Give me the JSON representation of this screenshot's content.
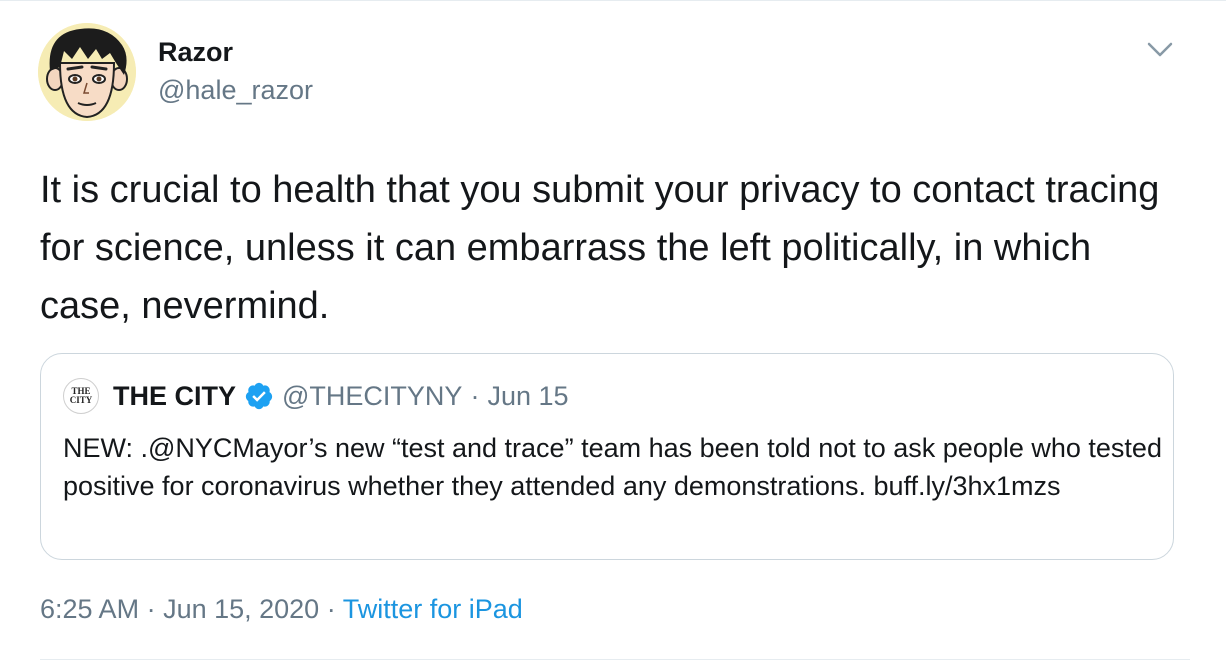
{
  "author": {
    "display_name": "Razor",
    "handle": "@hale_razor"
  },
  "tweet": {
    "text": "It is crucial to health that you submit your privacy to contact tracing for science, unless it can embarrass the left politically, in which case, nevermind."
  },
  "quoted_tweet": {
    "avatar_text_top": "THE",
    "avatar_text_bottom": "CITY",
    "display_name": "THE CITY",
    "handle": "@THECITYNY",
    "separator": "·",
    "date": "Jun 15",
    "text": "NEW: .@NYCMayor’s new “test and trace” team has been told not to ask people who tested positive for coronavirus whether they attended any demonstrations. buff.ly/3hx1mzs",
    "verified_icon": "verified-badge-icon"
  },
  "meta": {
    "time": "6:25 AM",
    "separator1": " · ",
    "date": "Jun 15, 2020",
    "separator2": " · ",
    "source": "Twitter for iPad"
  },
  "icons": {
    "menu": "chevron-down-icon",
    "verified": "verified-badge-icon"
  },
  "colors": {
    "text": "#14171a",
    "secondary": "#657786",
    "link": "#1b95e0",
    "verified": "#1da1f2",
    "border": "#ccd6dd"
  }
}
